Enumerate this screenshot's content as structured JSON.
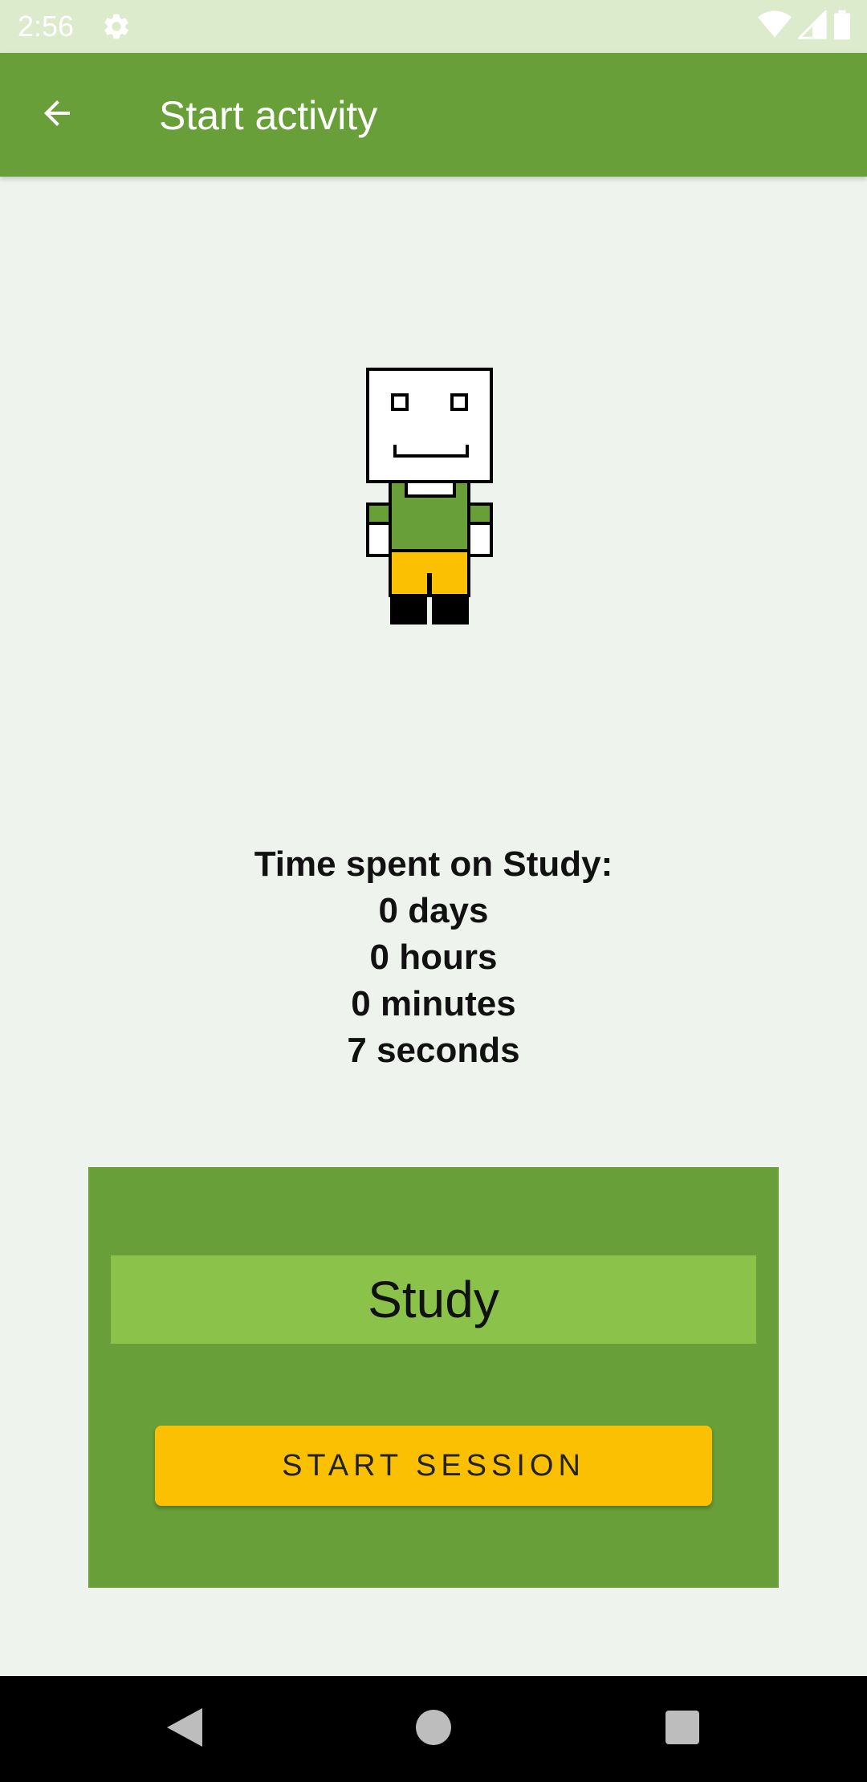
{
  "status_bar": {
    "time": "2:56",
    "icons": [
      "settings-gear-icon",
      "wifi-icon",
      "cell-signal-icon",
      "battery-icon"
    ]
  },
  "app_bar": {
    "back_icon": "arrow-back-icon",
    "title": "Start activity"
  },
  "avatar": {
    "icon": "pixel-character-icon"
  },
  "time_spent": {
    "heading": "Time spent on Study:",
    "days": "0 days",
    "hours": "0 hours",
    "minutes": "0 minutes",
    "seconds": "7 seconds"
  },
  "card": {
    "activity_name": "Study",
    "start_button_label": "START SESSION"
  },
  "nav_bar": {
    "buttons": [
      "back-triangle-icon",
      "home-circle-icon",
      "recents-square-icon"
    ]
  },
  "colors": {
    "primary": "#689f38",
    "light_green": "#8bc34a",
    "accent": "#fbc002",
    "status_bar": "#dcebcc",
    "background": "#eff3ee"
  }
}
